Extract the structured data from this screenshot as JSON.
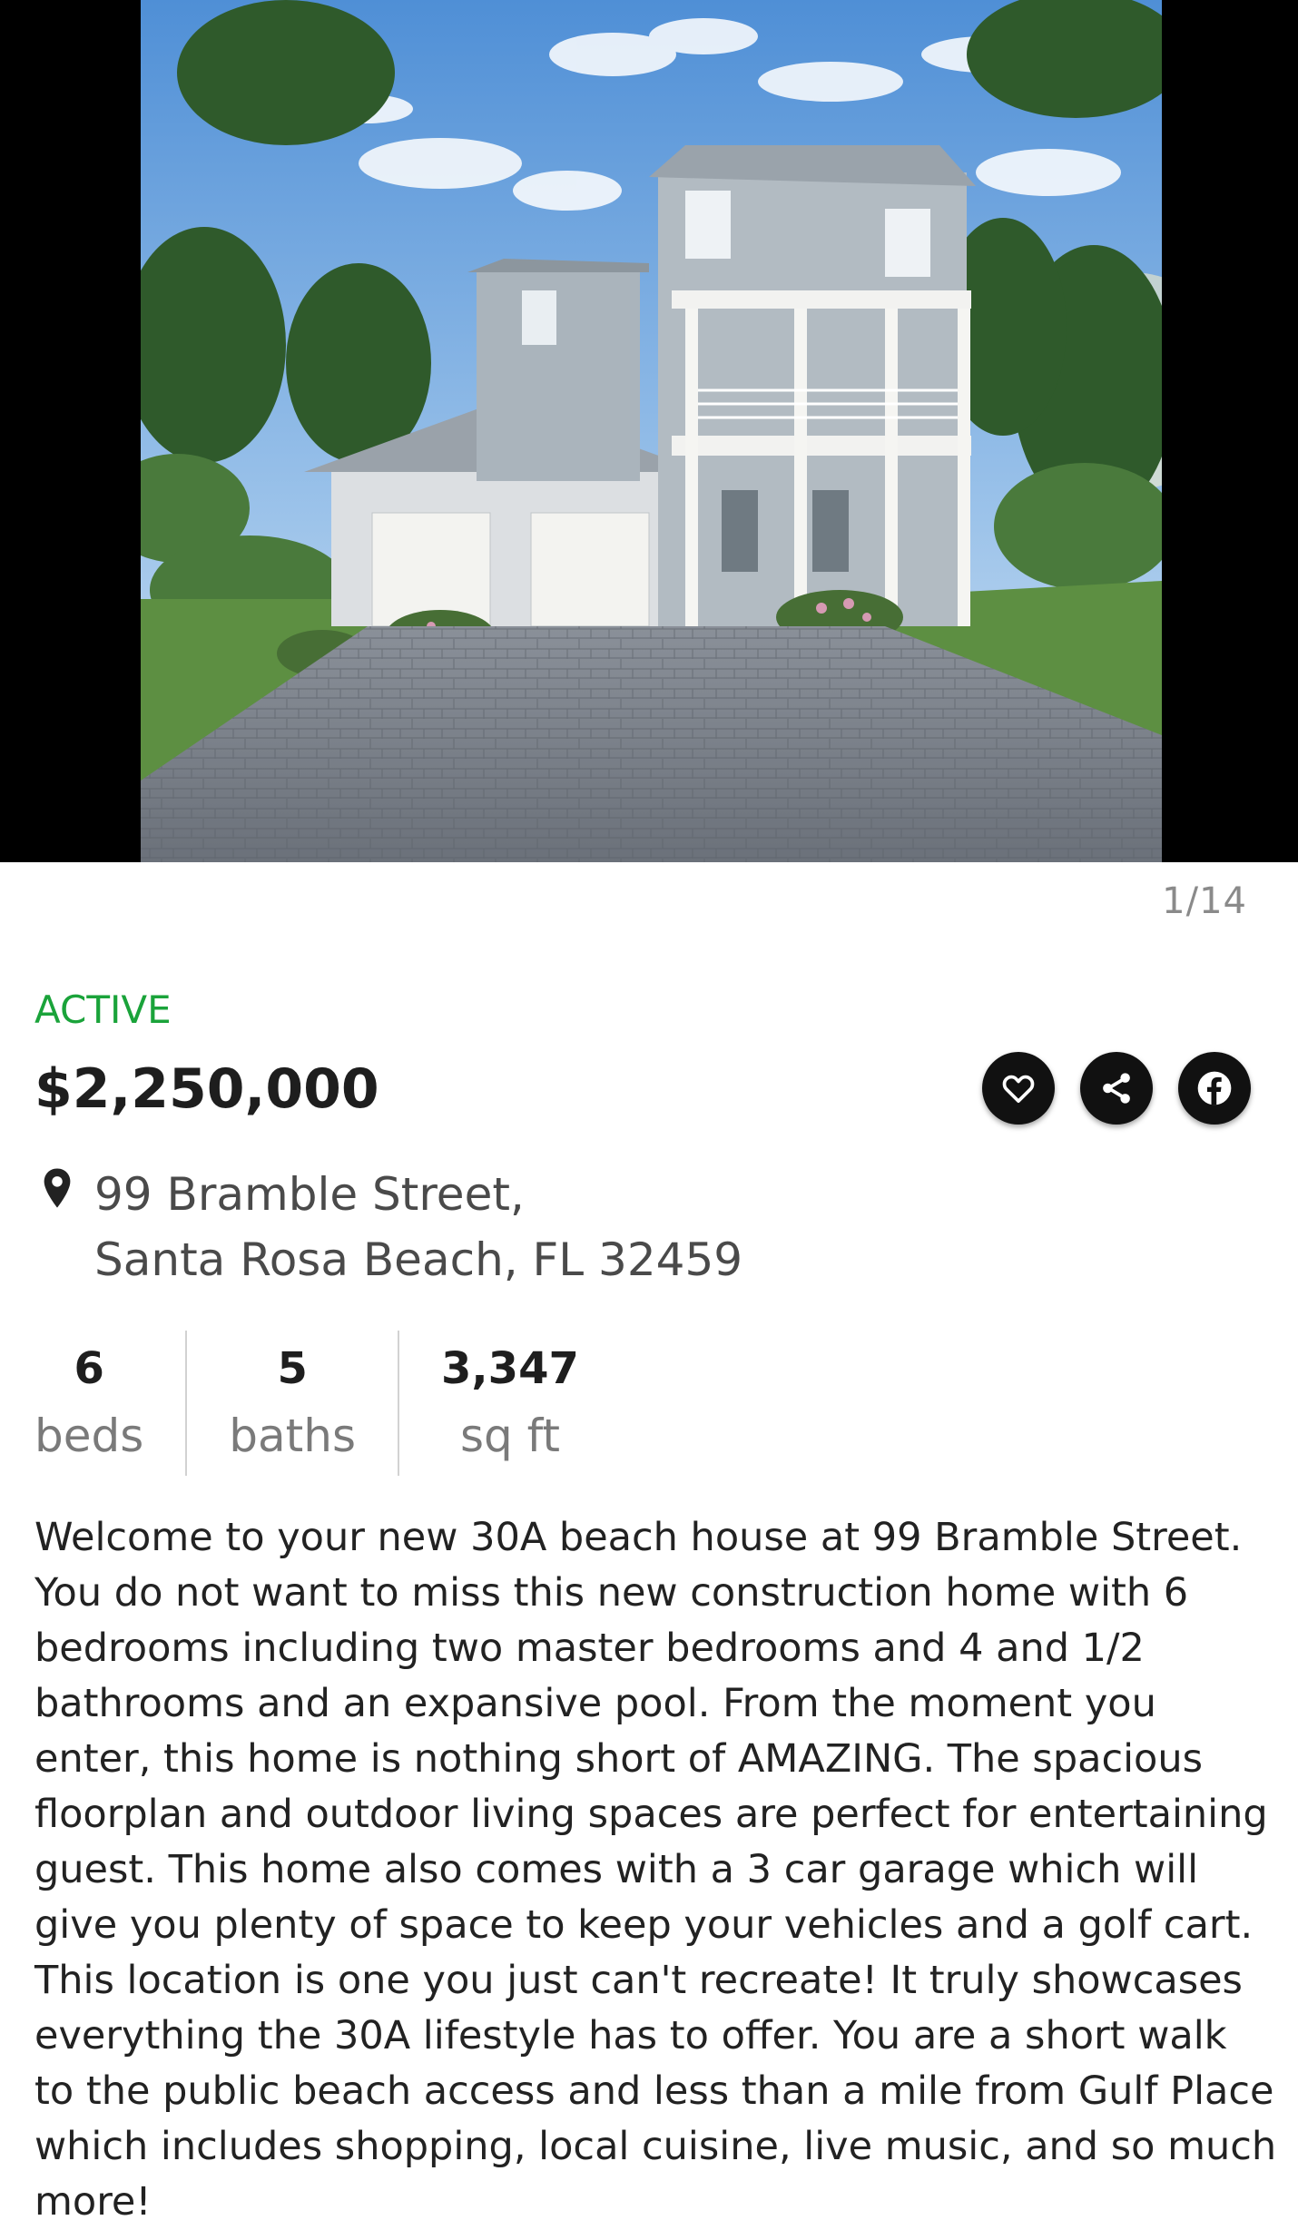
{
  "gallery": {
    "counter": "1/14"
  },
  "listing": {
    "status": "ACTIVE",
    "price": "$2,250,000",
    "address_line1": "99 Bramble Street,",
    "address_line2": "Santa Rosa Beach, FL 32459",
    "stats": [
      {
        "value": "6",
        "unit": "beds"
      },
      {
        "value": "5",
        "unit": "baths"
      },
      {
        "value": "3,347",
        "unit": "sq ft"
      }
    ],
    "description": "Welcome to your new 30A beach house at 99 Bramble Street. You do not want to miss this new construction home with 6 bedrooms including two master bedrooms and 4 and 1/2 bathrooms and an expansive pool. From the moment you enter, this home is nothing short of AMAZING. The spacious floorplan and outdoor living spaces are perfect for entertaining guest. This home also comes with a 3 car garage which will give you plenty of space to keep your vehicles and a golf cart. This location is one you just can't recreate! It truly showcases everything the 30A lifestyle has to offer. You are a short walk to the public beach access and less than a mile from Gulf Place which includes shopping, local cuisine, live music, and so much more!"
  },
  "actions": {
    "favorite_icon": "heart-icon",
    "share_icon": "share-icon",
    "facebook_icon": "facebook-icon"
  },
  "colors": {
    "status_green": "#1aa33a",
    "button_black": "#111111",
    "price_text": "#1e1e1e",
    "muted_text": "#7a7a7a"
  }
}
